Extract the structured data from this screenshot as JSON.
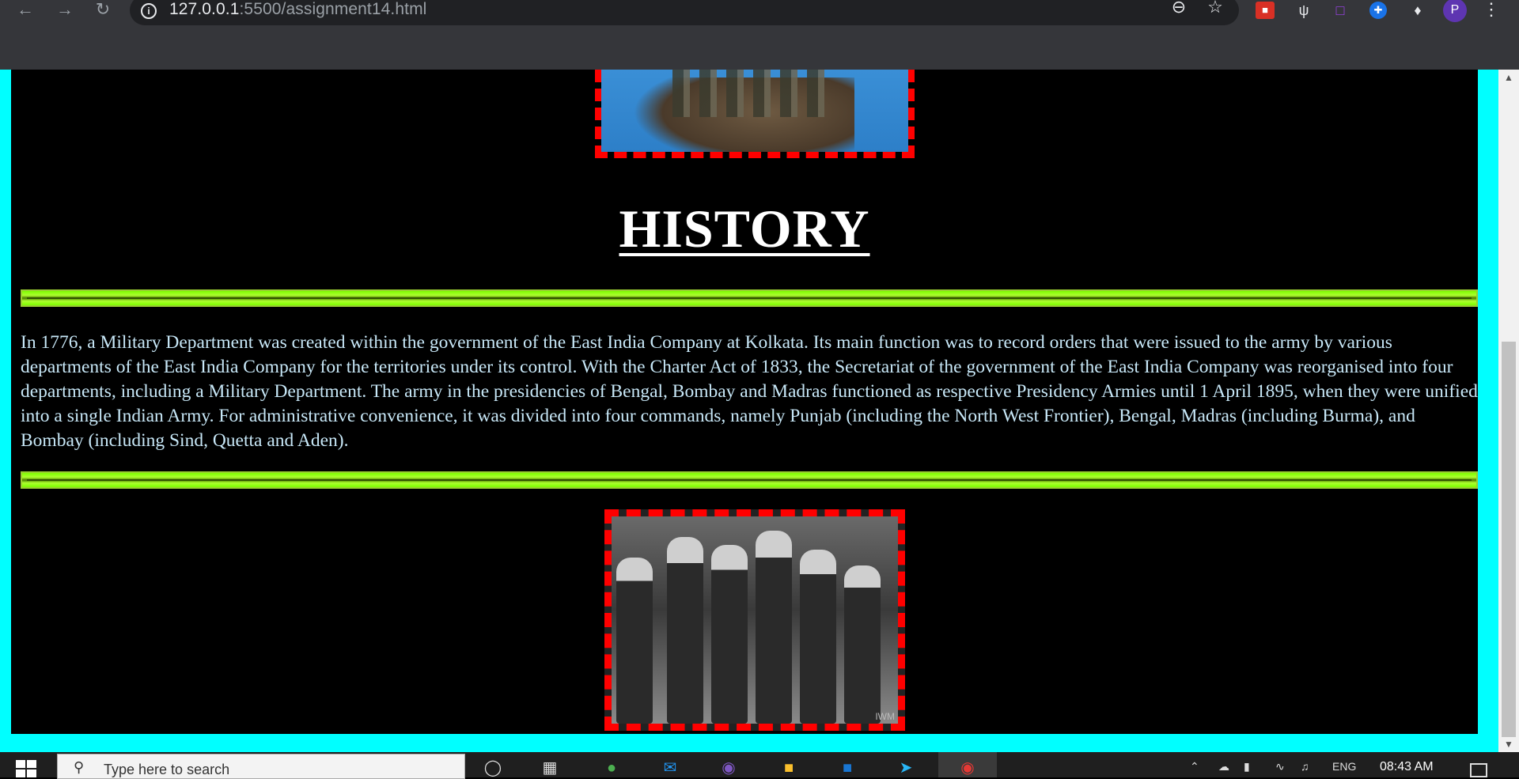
{
  "browser": {
    "url_host": "127.0.0.1",
    "url_port_path": ":5500/assignment14.html",
    "profile_initial": "P",
    "icons": [
      "back-arrow-icon",
      "forward-arrow-icon",
      "reload-icon",
      "info-icon",
      "zoom-out-icon",
      "bookmark-star-icon",
      "extensions-puzzle-icon",
      "more-vert-icon"
    ]
  },
  "page": {
    "heading": "HISTORY",
    "paragraph": "In 1776, a Military Department was created within the government of the East India Company at Kolkata. Its main function was to record orders that were issued to the army by various departments of the East India Company for the territories under its control. With the Charter Act of 1833, the Secretariat of the government of the East India Company was reorganised into four departments, including a Military Department. The army in the presidencies of Bengal, Bombay and Madras functioned as respective Presidency Armies until 1 April 1895, when they were unified into a single Indian Army. For administrative convenience, it was divided into four commands, namely Punjab (including the North West Frontier), Bengal, Madras (including Burma), and Bombay (including Sind, Quetta and Aden).",
    "bottom_image_watermark": "IWM",
    "colors": {
      "page_border": "#00ffff",
      "image_border": "#ff0000",
      "hr_color": "#7cfc00",
      "paragraph_text": "#c8e8f8",
      "heading_text": "#ffffff",
      "background": "#000000"
    }
  },
  "taskbar": {
    "search_placeholder": "Type here to search",
    "language": "ENG",
    "time": "08:43 AM"
  }
}
